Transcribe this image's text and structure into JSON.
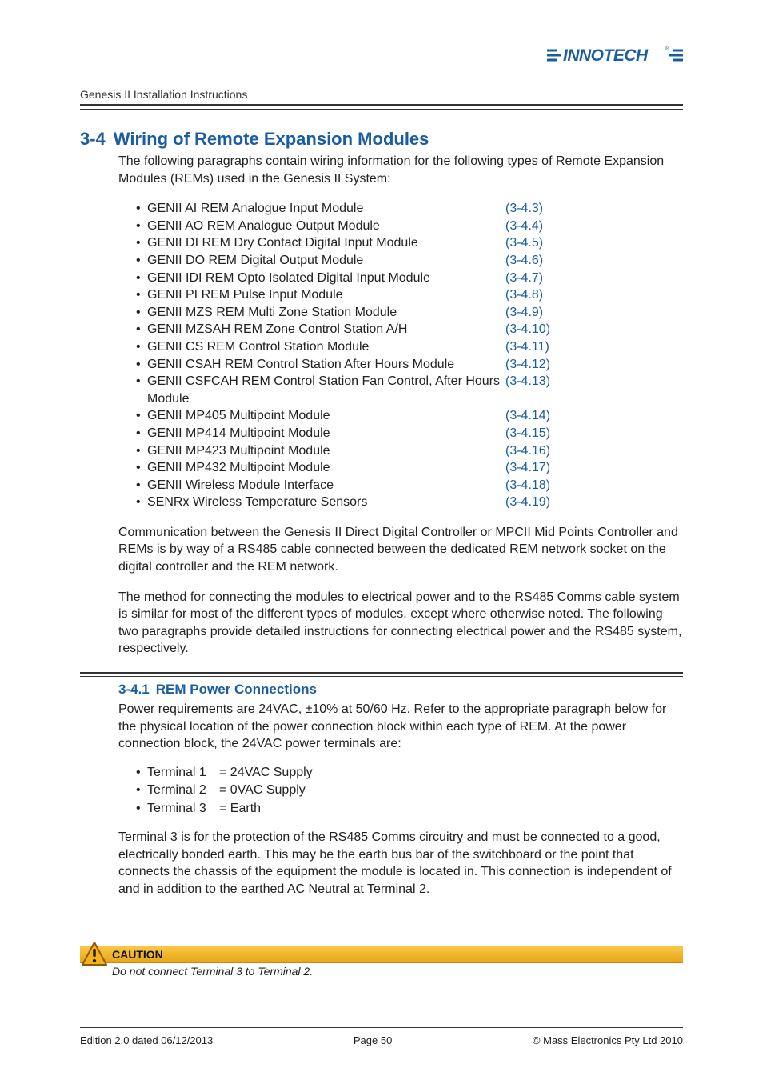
{
  "logo_text": "INNOTECH",
  "colors": {
    "primary": "#1a5ea0",
    "caution_bg": "#f0b429"
  },
  "header": {
    "breadcrumb": "Genesis II Installation Instructions"
  },
  "section": {
    "number": "3-4",
    "title": "Wiring of Remote Expansion Modules",
    "intro": "The following paragraphs contain wiring information for the following types of Remote Expansion Modules (REMs) used in the Genesis II System:",
    "modules": [
      {
        "name": "GENII AI REM Analogue Input Module",
        "ref": "(3-4.3)"
      },
      {
        "name": "GENII AO REM Analogue Output Module",
        "ref": "(3-4.4)"
      },
      {
        "name": "GENII DI REM Dry Contact Digital Input Module",
        "ref": "(3-4.5)"
      },
      {
        "name": "GENII DO REM Digital Output Module",
        "ref": "(3-4.6)"
      },
      {
        "name": "GENII IDI REM Opto Isolated Digital Input Module",
        "ref": "(3-4.7)"
      },
      {
        "name": "GENII PI REM Pulse Input Module",
        "ref": "(3-4.8)"
      },
      {
        "name": "GENII MZS REM Multi Zone Station Module",
        "ref": "(3-4.9)"
      },
      {
        "name": "GENII MZSAH REM Zone Control Station A/H",
        "ref": "(3-4.10)"
      },
      {
        "name": "GENII CS REM Control Station Module",
        "ref": "(3-4.11)"
      },
      {
        "name": "GENII CSAH REM Control Station After Hours Module",
        "ref": "(3-4.12)"
      },
      {
        "name": "GENII CSFCAH REM Control Station Fan Control, After Hours Module",
        "ref": "(3-4.13)"
      },
      {
        "name": "GENII MP405 Multipoint Module",
        "ref": "(3-4.14)"
      },
      {
        "name": "GENII MP414 Multipoint Module",
        "ref": "(3-4.15)"
      },
      {
        "name": "GENII MP423 Multipoint Module",
        "ref": "(3-4.16)"
      },
      {
        "name": "GENII MP432 Multipoint Module",
        "ref": "(3-4.17)"
      },
      {
        "name": "GENII Wireless Module Interface",
        "ref": "(3-4.18)"
      },
      {
        "name": "SENRx Wireless Temperature Sensors",
        "ref": "(3-4.19)"
      }
    ],
    "para2": "Communication between the Genesis II Direct Digital Controller or MPCII Mid Points Controller and REMs is by way of a RS485 cable connected between the dedicated REM network socket on the digital controller and the REM network.",
    "para3": "The method for connecting the modules to electrical power and to the RS485 Comms cable system is similar for most of the different types of modules, except where otherwise noted.  The following two paragraphs provide detailed instructions for connecting electrical power and the RS485 system, respectively."
  },
  "subsection": {
    "number": "3-4.1",
    "title": "REM Power Connections",
    "para1": "Power requirements are 24VAC, ±10% at 50/60 Hz.  Refer to the appropriate paragraph below for the physical location of the power connection block within each type of REM.  At the power connection block, the 24VAC power terminals are:",
    "terminals": [
      {
        "name": "Terminal 1",
        "value": "= 24VAC Supply"
      },
      {
        "name": "Terminal 2",
        "value": "= 0VAC Supply"
      },
      {
        "name": "Terminal 3",
        "value": "= Earth"
      }
    ],
    "para2": "Terminal 3 is for the protection of the RS485 Comms circuitry and must be connected to a good, electrically bonded earth.  This may be the earth bus bar of the switchboard or the point that connects the chassis of the equipment the module is located in.  This connection is independent of and in addition to the earthed AC Neutral at Terminal 2."
  },
  "caution": {
    "label": "CAUTION",
    "text": "Do not connect Terminal 3 to Terminal 2."
  },
  "footer": {
    "left": "Edition 2.0 dated 06/12/2013",
    "center": "Page 50",
    "right": "© Mass Electronics Pty Ltd  2010"
  }
}
